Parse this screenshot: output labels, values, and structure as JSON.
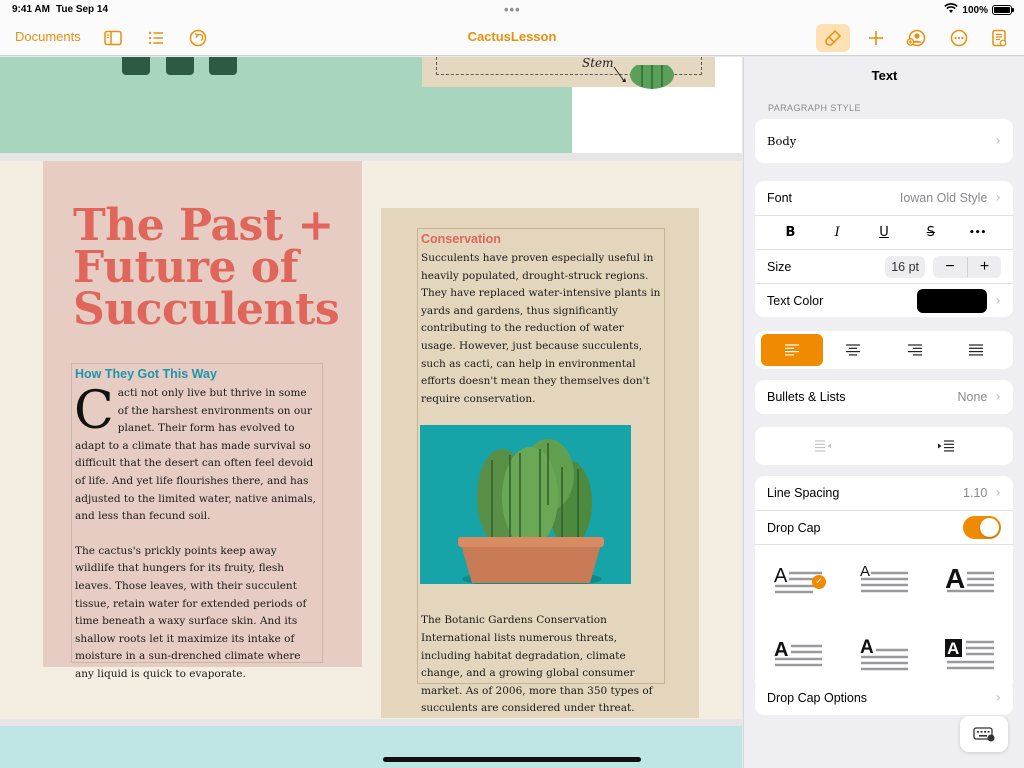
{
  "status_bar": {
    "time": "9:41 AM",
    "date": "Tue Sep 14",
    "battery": "100%"
  },
  "toolbar": {
    "documents_label": "Documents",
    "doc_title": "CactusLesson"
  },
  "document": {
    "stem_label": "Stem",
    "headline": "The Past + Future of Succulents",
    "col1": {
      "subheading": "How They Got This Way",
      "drop_cap": "C",
      "para1": "acti not only live but thrive in some of the harshest environments on our planet. Their form has evolved to adapt to a climate that has made survival so difficult that the desert can often feel devoid of life. And yet life flourishes there, and has adjusted to the limited water, native animals, and less than fecund soil.",
      "para2": "The cactus's prickly points keep away wildlife that hungers for its fruity, flesh leaves. Those leaves, with their succulent tissue, retain water for extended periods of time beneath a waxy surface skin. And its shallow roots let it maximize its intake of moisture in a sun-drenched climate where any liquid is quick to evaporate."
    },
    "col2": {
      "subheading": "Conservation",
      "para1": "Succulents have proven especially useful in heavily populated, drought-struck regions. They have replaced water-intensive plants in yards and gardens, thus significantly contributing to the reduction of water usage. However, just because succulents, such as cacti, can help in environmental efforts doesn't mean they themselves don't require conservation.",
      "para2": "The Botanic Gardens Conservation International lists numerous threats, including habitat degradation, climate change, and a growing global consumer market. As of 2006, more than 350 types of succulents are considered under threat."
    }
  },
  "inspector": {
    "title": "Text",
    "paragraph_style_label": "PARAGRAPH STYLE",
    "paragraph_style_value": "Body",
    "font_label": "Font",
    "font_value": "Iowan Old Style",
    "format_buttons": [
      "B",
      "I",
      "U",
      "S",
      "•••"
    ],
    "size_label": "Size",
    "size_value": "16 pt",
    "size_minus": "−",
    "size_plus": "+",
    "text_color_label": "Text Color",
    "text_color": "#000000",
    "alignment_selected": "left",
    "bullets_label": "Bullets & Lists",
    "bullets_value": "None",
    "line_spacing_label": "Line Spacing",
    "line_spacing_value": "1.10",
    "drop_cap_label": "Drop Cap",
    "drop_cap_on": true,
    "drop_cap_glyph": "A",
    "drop_cap_selected_index": 0,
    "drop_cap_options_label": "Drop Cap Options"
  },
  "colors": {
    "accent": "#F08A00",
    "headline": "#E0665B",
    "subheading_teal": "#1F94AD"
  }
}
